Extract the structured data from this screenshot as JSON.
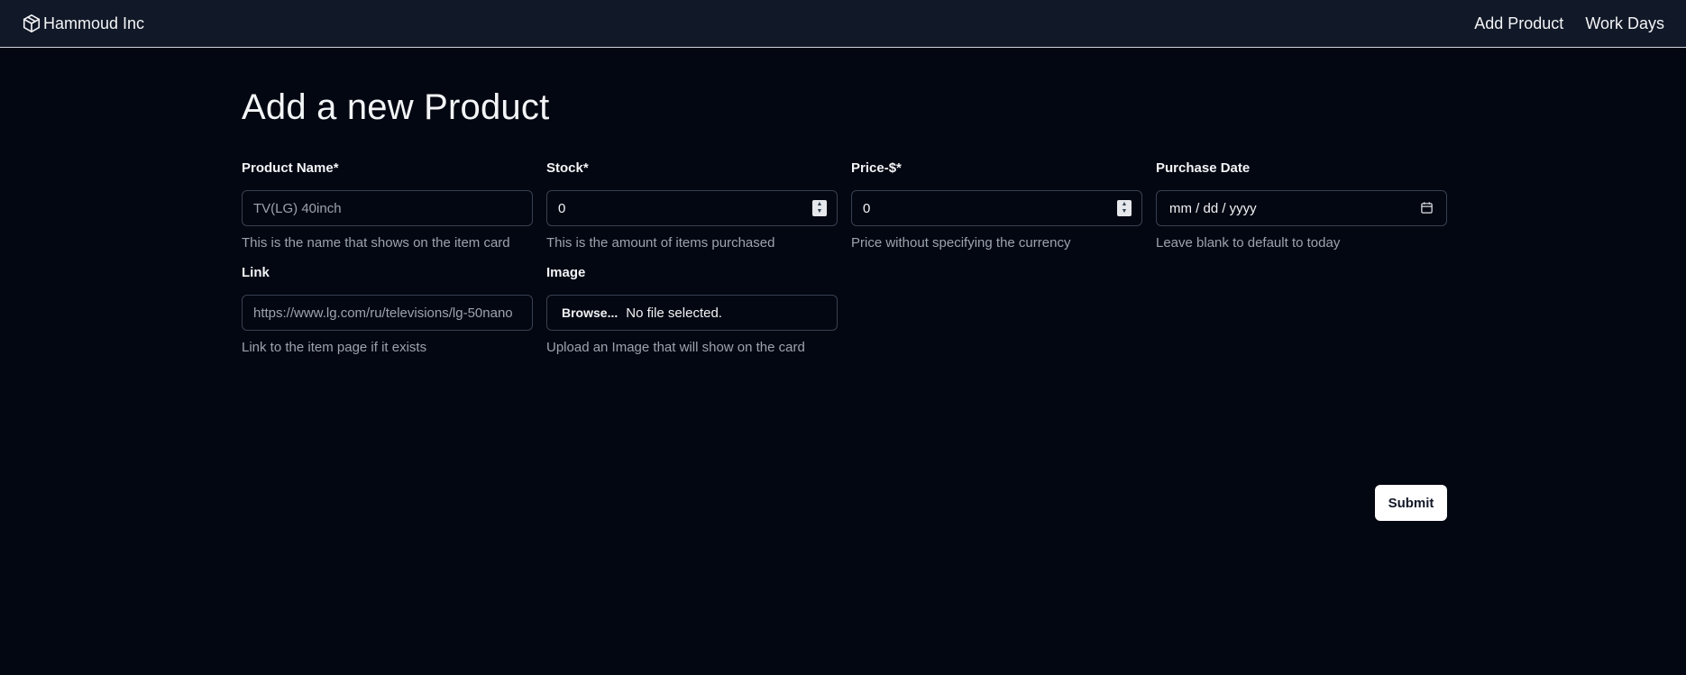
{
  "nav": {
    "brand": "Hammoud Inc",
    "links": [
      "Add Product",
      "Work Days"
    ]
  },
  "page": {
    "title": "Add a new Product"
  },
  "form": {
    "product_name": {
      "label": "Product Name*",
      "placeholder": "TV(LG) 40inch",
      "help": "This is the name that shows on the item card"
    },
    "stock": {
      "label": "Stock*",
      "value": "0",
      "help": "This is the amount of items purchased"
    },
    "price": {
      "label": "Price-$*",
      "value": "0",
      "help": "Price without specifying the currency"
    },
    "purchase_date": {
      "label": "Purchase Date",
      "placeholder": "mm / dd / yyyy",
      "help": "Leave blank to default to today"
    },
    "link": {
      "label": "Link",
      "placeholder": "https://www.lg.com/ru/televisions/lg-50nano",
      "help": "Link to the item page if it exists"
    },
    "image": {
      "label": "Image",
      "browse_label": "Browse...",
      "status": "No file selected.",
      "help": "Upload an Image that will show on the card"
    },
    "submit_label": "Submit"
  },
  "icons": {
    "brand": "cube-icon",
    "date": "calendar-icon",
    "spinner": "spinner-arrows-icon"
  },
  "colors": {
    "background": "#030712",
    "navbar": "#111827",
    "border": "#374151",
    "muted_text": "#9ca3af"
  }
}
